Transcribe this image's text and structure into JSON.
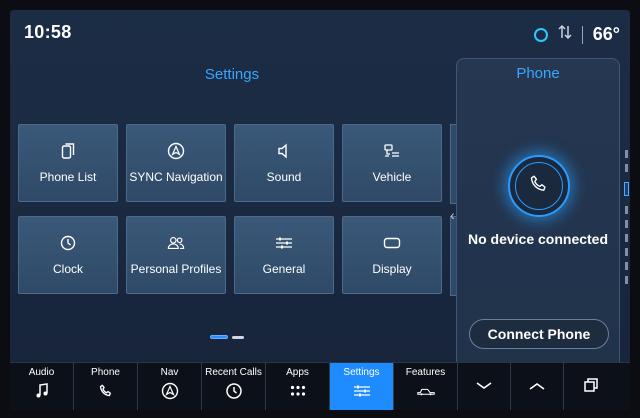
{
  "status_bar": {
    "time": "10:58",
    "temperature": "66°"
  },
  "settings": {
    "title": "Settings",
    "tiles": [
      {
        "label": "Phone List",
        "icon": "phone-list-icon"
      },
      {
        "label": "SYNC Navigation",
        "icon": "navigation-icon"
      },
      {
        "label": "Sound",
        "icon": "speaker-icon"
      },
      {
        "label": "Vehicle",
        "icon": "vehicle-icon"
      },
      {
        "label": "Clock",
        "icon": "clock-icon"
      },
      {
        "label": "Personal Profiles",
        "icon": "profiles-icon"
      },
      {
        "label": "General",
        "icon": "sliders-icon"
      },
      {
        "label": "Display",
        "icon": "display-icon"
      }
    ]
  },
  "phone_panel": {
    "title": "Phone",
    "status": "No device connected",
    "connect_label": "Connect Phone"
  },
  "bottom_nav": {
    "items": [
      {
        "label": "Audio",
        "icon": "music-note-icon",
        "active": false
      },
      {
        "label": "Phone",
        "icon": "phone-icon",
        "active": false
      },
      {
        "label": "Nav",
        "icon": "navigation-icon",
        "active": false
      },
      {
        "label": "Recent Calls",
        "icon": "recent-calls-icon",
        "active": false
      },
      {
        "label": "Apps",
        "icon": "apps-grid-icon",
        "active": false
      },
      {
        "label": "Settings",
        "icon": "settings-sliders-icon",
        "active": true
      },
      {
        "label": "Features",
        "icon": "features-car-icon",
        "active": false
      }
    ],
    "controls": [
      "chevron-down-icon",
      "chevron-up-icon",
      "windows-icon"
    ]
  },
  "colors": {
    "accent": "#1e8cff",
    "title_blue": "#3aa6ff",
    "alexa": "#2ec7ff"
  }
}
